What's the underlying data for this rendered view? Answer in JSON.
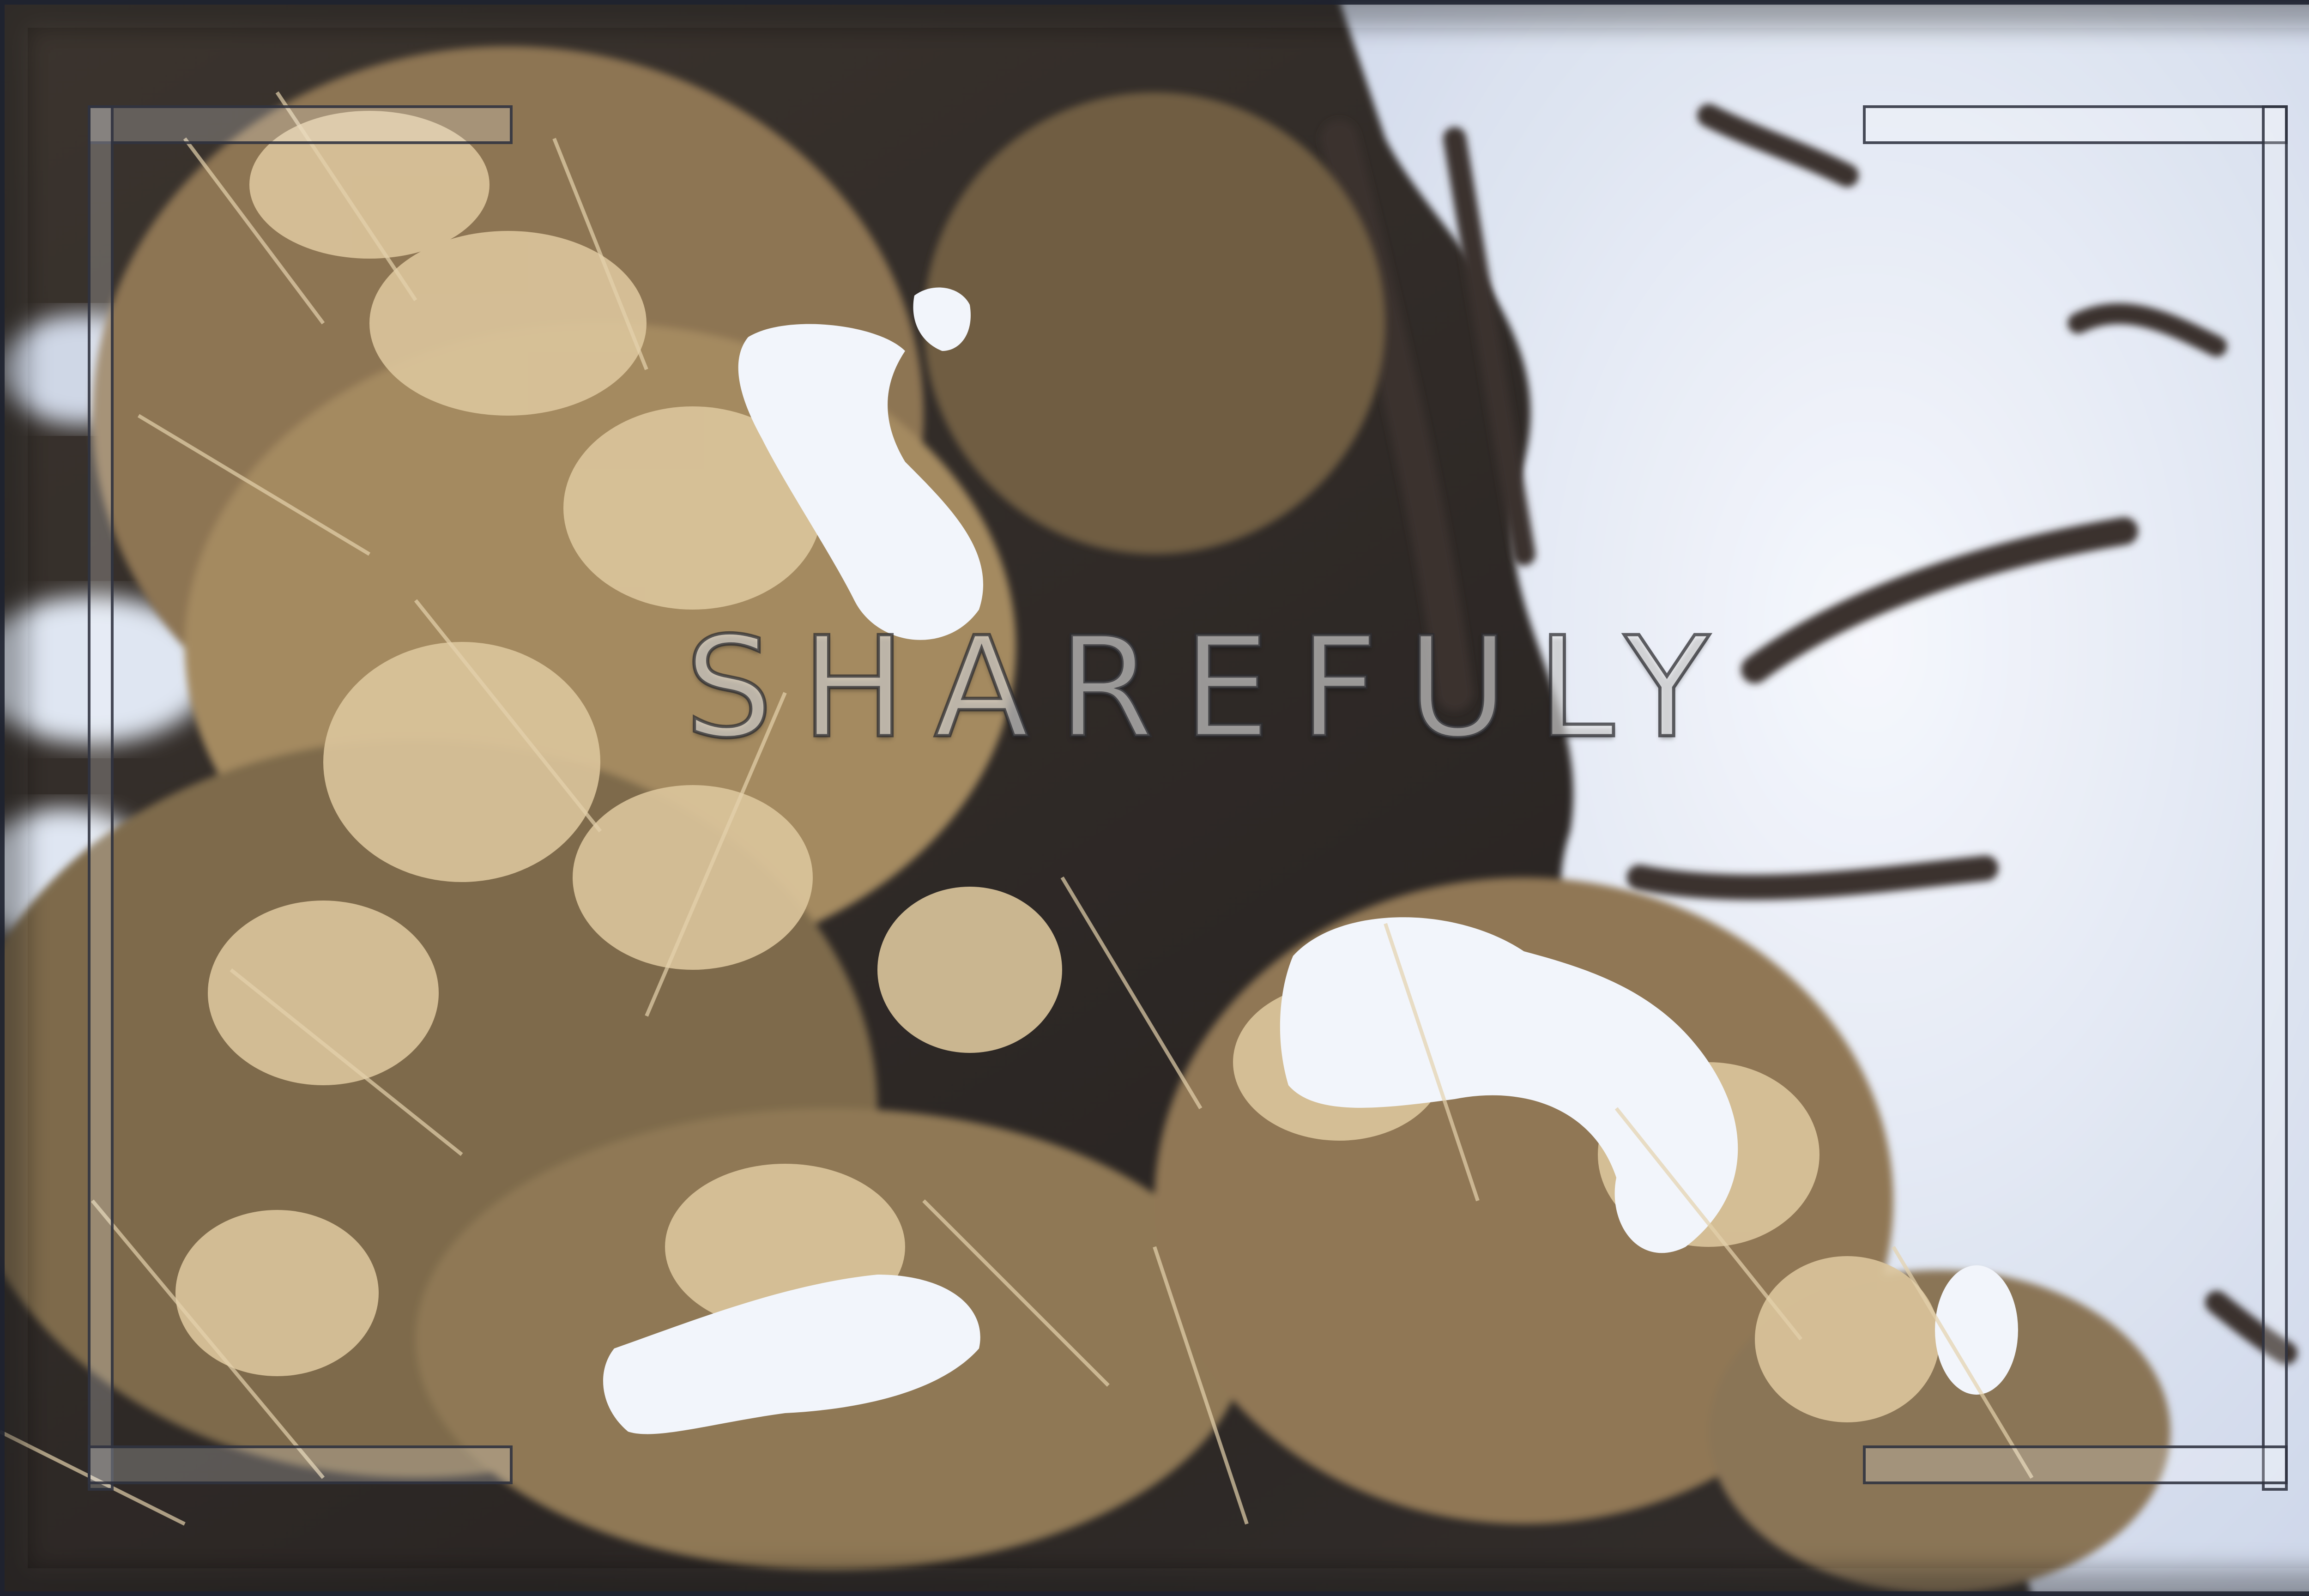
{
  "watermark": {
    "text": "SHAREFULY"
  },
  "scene": {
    "subject": "snow-dusted-dry-grass",
    "colors": {
      "snow": "#eef2fa",
      "snow_shadow": "#c9d2e4",
      "grass_light": "#d9c39a",
      "grass_mid": "#b89b6c",
      "grass_dark": "#6e5a3f",
      "ground_dark": "#2f2a28",
      "frame_bracket": "#2c3042"
    }
  }
}
